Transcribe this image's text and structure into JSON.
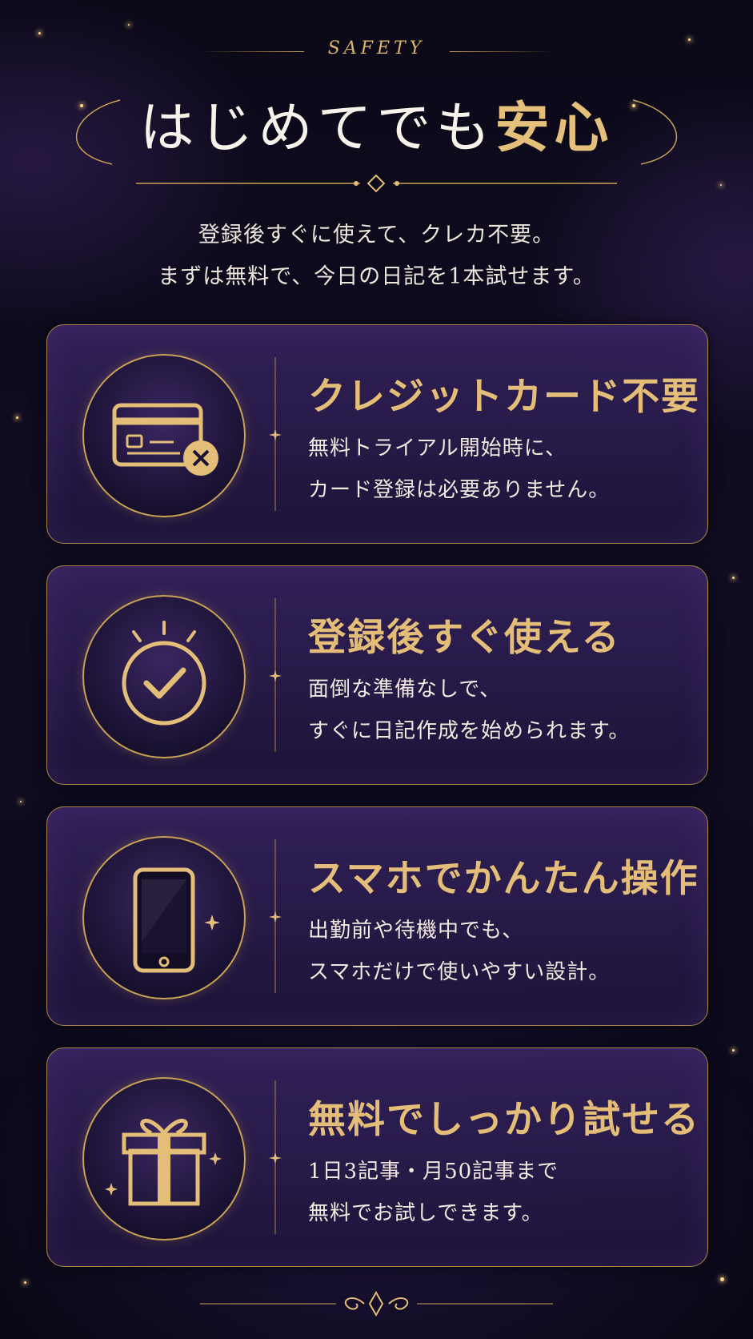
{
  "header": {
    "eyebrow": "SAFETY",
    "title_plain": "はじめてでも",
    "title_accent": "安心",
    "intro_line1": "登録後すぐに使えて、クレカ不要。",
    "intro_line2": "まずは無料で、今日の日記を1本試せます。"
  },
  "colors": {
    "gold": "#e4be78",
    "background": "#0e0a1f",
    "card": "#2a1c4e"
  },
  "features": [
    {
      "icon": "credit-card-x-icon",
      "title": "クレジットカード不要",
      "line1": "無料トライアル開始時に、",
      "line2": "カード登録は必要ありません。"
    },
    {
      "icon": "check-circle-icon",
      "title": "登録後すぐ使える",
      "line1": "面倒な準備なしで、",
      "line2": "すぐに日記作成を始められます。"
    },
    {
      "icon": "smartphone-icon",
      "title": "スマホでかんたん操作",
      "line1": "出勤前や待機中でも、",
      "line2": "スマホだけで使いやすい設計。"
    },
    {
      "icon": "gift-box-icon",
      "title": "無料でしっかり試せる",
      "line1": "1日3記事・月50記事まで",
      "line2": "無料でお試しできます。"
    }
  ]
}
